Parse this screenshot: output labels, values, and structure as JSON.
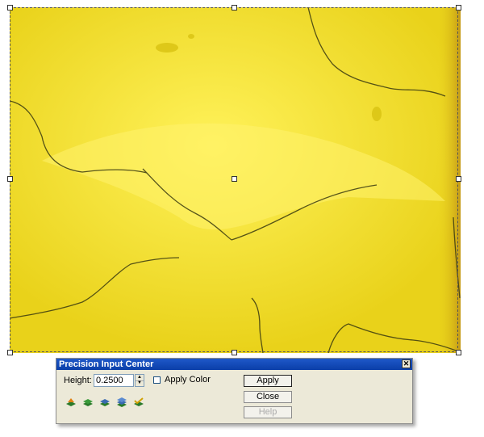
{
  "dialog": {
    "title": "Precision Input Center",
    "height_label": "Height:",
    "height_value": "0.2500",
    "apply_color_label": "Apply Color",
    "apply_color_checked": false,
    "apply_button": "Apply",
    "close_button": "Close",
    "help_button": "Help",
    "tool_icons": [
      "layer-shape-icon",
      "layer-green-icon",
      "layer-blue-icon",
      "layer-stack-icon",
      "layer-check-icon"
    ]
  },
  "canvas": {
    "relief_color": "#f2dc1a"
  }
}
